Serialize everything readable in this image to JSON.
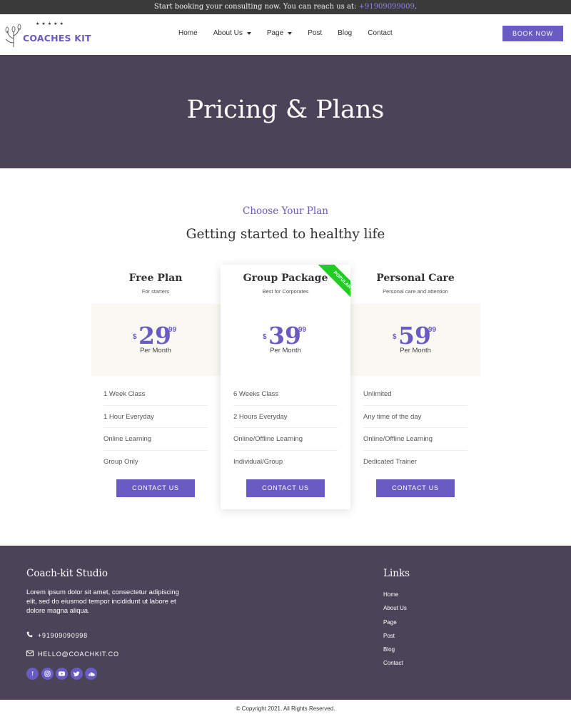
{
  "topbar": {
    "text": "Start booking your consulting now. You can reach us at: ",
    "phone": "+91909099009",
    "end": "."
  },
  "header": {
    "logo_text": "COACHES KIT",
    "logo_stars": "★★★★★",
    "nav": [
      {
        "label": "Home",
        "caret": false
      },
      {
        "label": "About Us",
        "caret": true
      },
      {
        "label": "Page",
        "caret": true
      },
      {
        "label": "Post",
        "caret": false
      },
      {
        "label": "Blog",
        "caret": false
      },
      {
        "label": "Contact",
        "caret": false
      }
    ],
    "book_label": "BOOK NOW"
  },
  "hero": {
    "title": "Pricing & Plans"
  },
  "section": {
    "eyebrow": "Choose Your Plan",
    "heading": "Getting started to healthy life"
  },
  "plans": [
    {
      "title": "Free Plan",
      "subtitle": "For starters",
      "currency": "$",
      "amount": "29",
      "cents": "99",
      "period": "Per Month",
      "features": [
        "1 Week Class",
        "1 Hour Everyday",
        "Online Learning",
        "Group Only"
      ],
      "button": "CONTACT US",
      "featured": false
    },
    {
      "title": "Group Package",
      "subtitle": "Best for Corporates",
      "currency": "$",
      "amount": "39",
      "cents": "99",
      "period": "Per Month",
      "features": [
        "6 Weeks Class",
        "2 Hours Everyday",
        "Online/Offline Learning",
        "Individual/Group"
      ],
      "button": "CONTACT US",
      "featured": true,
      "ribbon": "POPULAR"
    },
    {
      "title": "Personal Care",
      "subtitle": "Personal care and attention",
      "currency": "$",
      "amount": "59",
      "cents": "99",
      "period": "Per Month",
      "features": [
        "Unlimited",
        "Any time of the day",
        "Online/Offline Learning",
        "Dedicated Trainer"
      ],
      "button": "CONTACT US",
      "featured": false
    }
  ],
  "footer": {
    "studio_title": "Coach-kit Studio",
    "about": "Lorem ipsum dolor sit amet, consectetur adipiscing elit, sed do eiusmod tempor incididunt ut labore et dolore magna aliqua.",
    "phone": "+91909090998",
    "email": "HELLO@COACHKIT.CO",
    "links_title": "Links",
    "links": [
      "Home",
      "About Us",
      "Page",
      "Post",
      "Blog",
      "Contact"
    ],
    "socials": [
      "facebook-icon",
      "instagram-icon",
      "youtube-icon",
      "twitter-icon",
      "soundcloud-icon"
    ]
  },
  "copyright": "© Copyright 2021. All Rights Reserved.",
  "colors": {
    "accent": "#6a5bc2",
    "dark": "#4b4459",
    "ribbon": "#22cc22",
    "band": "#faf8f2"
  }
}
